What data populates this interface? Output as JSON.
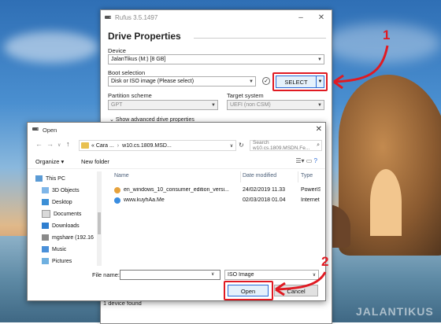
{
  "rufus": {
    "title": "Rufus 3.5.1497",
    "heading": "Drive Properties",
    "device_label": "Device",
    "device_value": "JalanTikus (M:) [8 GB]",
    "boot_label": "Boot selection",
    "boot_value": "Disk or ISO image (Please select)",
    "select_label": "SELECT",
    "partition_label": "Partition scheme",
    "partition_value": "GPT",
    "target_label": "Target system",
    "target_value": "UEFI (non CSM)",
    "advanced_toggle": "Show advanced drive properties",
    "status": "1 device found"
  },
  "open_dialog": {
    "title": "Open",
    "breadcrumb": [
      "« Cara ...",
      "w10.cs.1809.MSD..."
    ],
    "search_placeholder": "Search w10.cs.1809.MSDN.Fe...",
    "organize_label": "Organize",
    "new_folder_label": "New folder",
    "nav_items": [
      {
        "label": "This PC",
        "icon": "computer-icon"
      },
      {
        "label": "3D Objects",
        "icon": "3d-objects-icon"
      },
      {
        "label": "Desktop",
        "icon": "desktop-icon"
      },
      {
        "label": "Documents",
        "icon": "documents-icon"
      },
      {
        "label": "Downloads",
        "icon": "downloads-icon"
      },
      {
        "label": "mgshare (192.16",
        "icon": "network-drive-icon"
      },
      {
        "label": "Music",
        "icon": "music-icon"
      },
      {
        "label": "Pictures",
        "icon": "pictures-icon"
      }
    ],
    "columns": {
      "name": "Name",
      "date": "Date modified",
      "type": "Type"
    },
    "files": [
      {
        "name": "en_windows_10_consumer_edition_versi...",
        "date": "24/02/2019 11.33",
        "type": "PowerISO",
        "icon": "iso-file-icon"
      },
      {
        "name": "www.kuyhAa.Me",
        "date": "02/03/2018 01.04",
        "type": "Internet S",
        "icon": "internet-shortcut-icon"
      }
    ],
    "filename_label": "File name:",
    "filename_value": "",
    "filetype_value": "ISO Image",
    "open_label": "Open",
    "cancel_label": "Cancel"
  },
  "callouts": {
    "one": "1",
    "two": "2"
  },
  "watermark": "JALANTIKUS",
  "colors": {
    "highlight": "#e01a22",
    "accent_button": "#2b6bd6",
    "folder": "#e8c050"
  }
}
